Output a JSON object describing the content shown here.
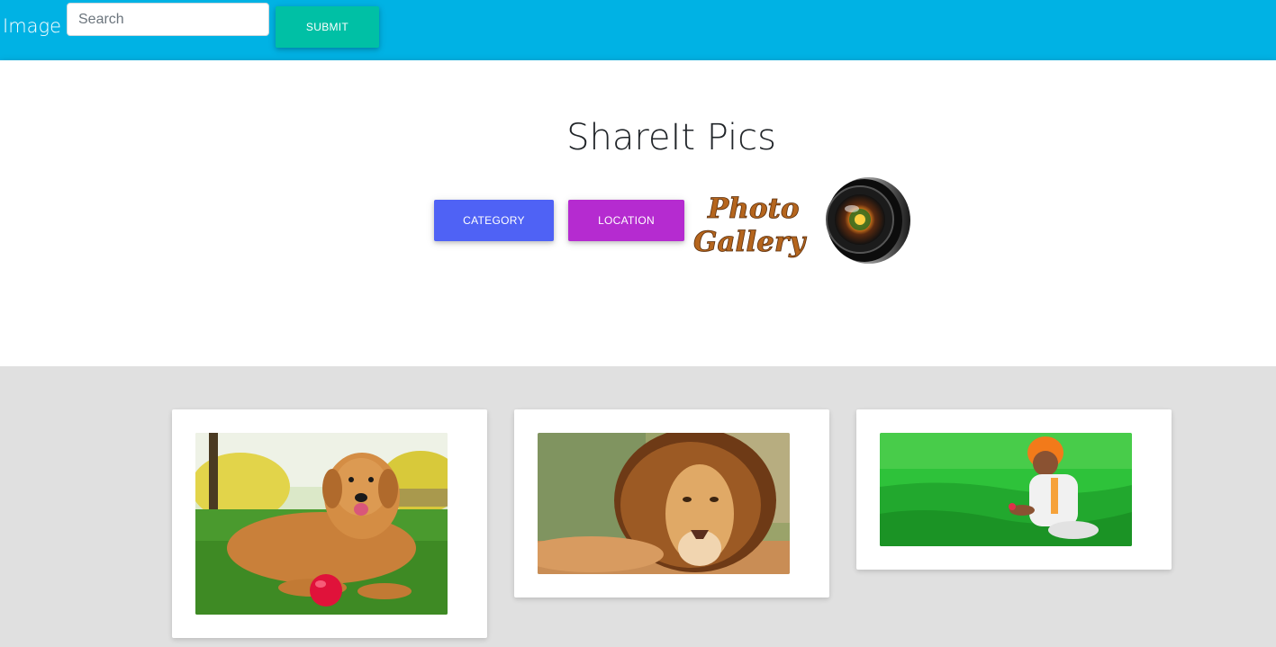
{
  "navbar": {
    "brand": "Image",
    "search_placeholder": "Search",
    "search_value": "",
    "submit_label": "SUBMIT",
    "color": "#00b2e4"
  },
  "hero": {
    "title": "ShareIt Pics",
    "category_label": "CATEGORY",
    "location_label": "LOCATION",
    "logo": {
      "line1": "Photo",
      "line2": "Gallery"
    }
  },
  "colors": {
    "submit": "#00c0a5",
    "category": "#4f62f5",
    "location": "#b52bd0",
    "page_bg": "#e0e0e0"
  },
  "gallery": {
    "items": [
      {
        "subject": "golden retriever with red ball on grass",
        "icon": "dog-photo"
      },
      {
        "subject": "male lion lying down",
        "icon": "lion-photo"
      },
      {
        "subject": "farmer in orange turban in green field",
        "icon": "farmer-photo"
      }
    ]
  }
}
